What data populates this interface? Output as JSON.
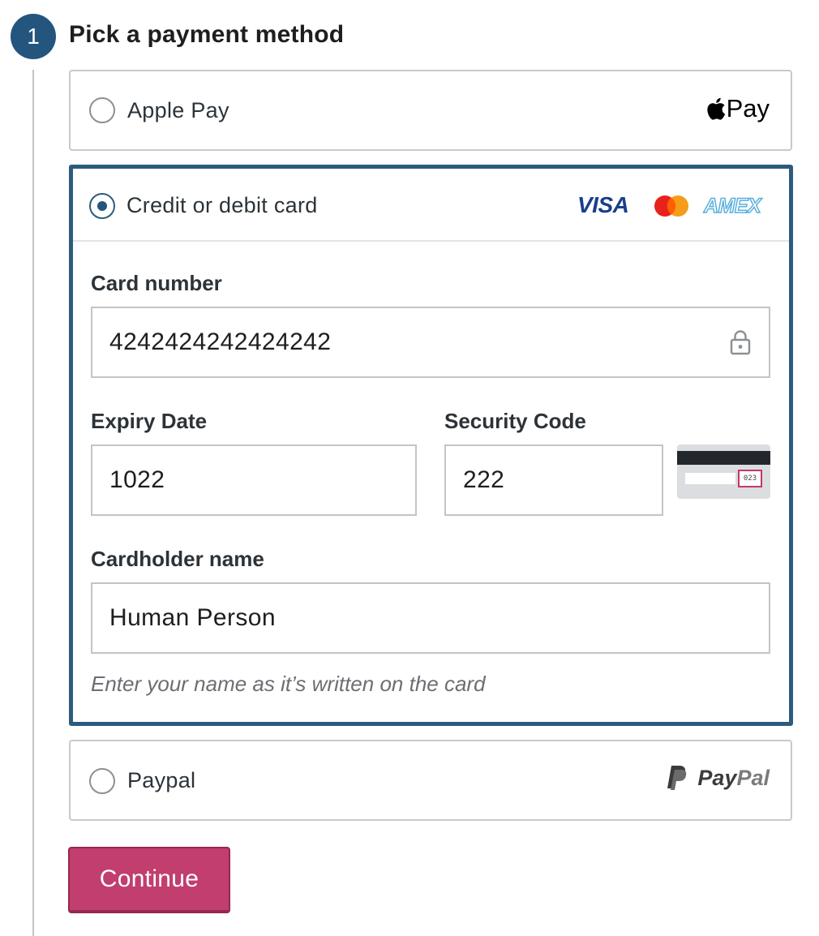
{
  "step": {
    "number": "1",
    "title": "Pick a payment method"
  },
  "options": {
    "apple_pay": {
      "label": "Apple Pay",
      "logo_text": "Pay",
      "selected": false
    },
    "card": {
      "label": "Credit or debit card",
      "selected": true,
      "brands": {
        "visa": "VISA",
        "amex": "AMEX"
      }
    },
    "paypal": {
      "label": "Paypal",
      "logo_text_a": "Pay",
      "logo_text_b": "Pal",
      "selected": false
    }
  },
  "form": {
    "card_number": {
      "label": "Card number",
      "value": "4242424242424242"
    },
    "expiry": {
      "label": "Expiry Date",
      "value": "1022"
    },
    "security": {
      "label": "Security Code",
      "value": "222",
      "card_hint_code": "023"
    },
    "cardholder": {
      "label": "Cardholder name",
      "value": "Human Person",
      "hint": "Enter your name as it’s written on the card"
    }
  },
  "actions": {
    "continue_label": "Continue"
  },
  "colors": {
    "accent": "#23557e",
    "selected_border": "#2c5b7c",
    "button": "#c13e6e"
  },
  "icons": [
    "apple-icon",
    "lock-icon",
    "visa-logo",
    "mastercard-logo",
    "amex-logo",
    "cvc-card-icon",
    "paypal-icon"
  ]
}
